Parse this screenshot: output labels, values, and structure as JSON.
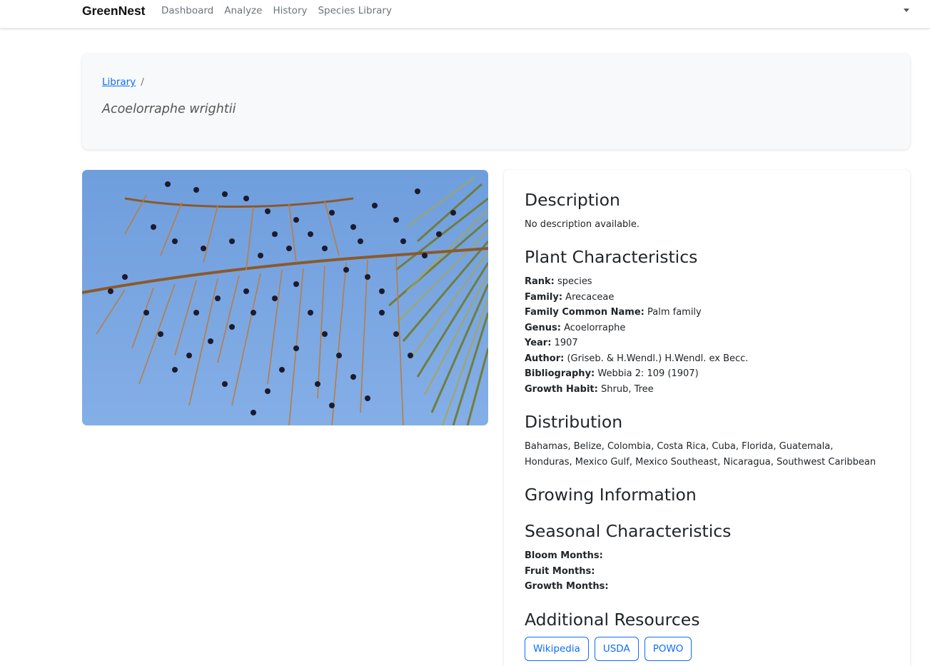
{
  "navbar": {
    "brand": "GreenNest",
    "links": [
      "Dashboard",
      "Analyze",
      "History",
      "Species Library"
    ]
  },
  "header": {
    "breadcrumb_link": "Library",
    "breadcrumb_sep": "/",
    "species_name": "Acoelorraphe wrightii"
  },
  "photo": {
    "alt": "Acoelorraphe wrightii"
  },
  "description": {
    "heading": "Description",
    "text": "No description available."
  },
  "characteristics": {
    "heading": "Plant Characteristics",
    "items": [
      {
        "label": "Rank:",
        "value": "species"
      },
      {
        "label": "Family:",
        "value": "Arecaceae"
      },
      {
        "label": "Family Common Name:",
        "value": "Palm family"
      },
      {
        "label": "Genus:",
        "value": "Acoelorraphe"
      },
      {
        "label": "Year:",
        "value": "1907"
      },
      {
        "label": "Author:",
        "value": "(Griseb. & H.Wendl.) H.Wendl. ex Becc."
      },
      {
        "label": "Bibliography:",
        "value": "Webbia 2: 109 (1907)"
      },
      {
        "label": "Growth Habit:",
        "value": "Shrub, Tree"
      }
    ]
  },
  "distribution": {
    "heading": "Distribution",
    "text": "Bahamas, Belize, Colombia, Costa Rica, Cuba, Florida, Guatemala, Honduras, Mexico Gulf, Mexico Southeast, Nicaragua, Southwest Caribbean"
  },
  "growing": {
    "heading": "Growing Information"
  },
  "seasonal": {
    "heading": "Seasonal Characteristics",
    "items": [
      {
        "label": "Bloom Months:",
        "value": ""
      },
      {
        "label": "Fruit Months:",
        "value": ""
      },
      {
        "label": "Growth Months:",
        "value": ""
      }
    ]
  },
  "resources": {
    "heading": "Additional Resources",
    "buttons": [
      "Wikipedia",
      "USDA",
      "POWO"
    ]
  }
}
